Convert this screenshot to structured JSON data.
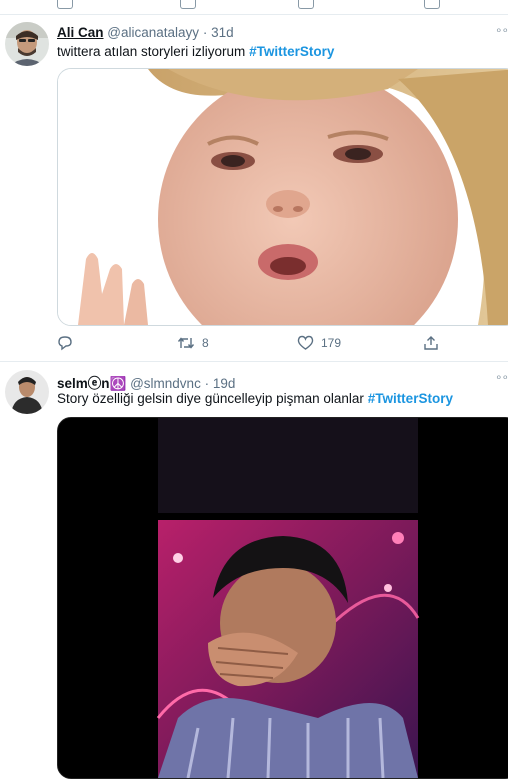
{
  "tweets": [
    {
      "display_name": "Ali Can",
      "handle": "@alicanatalayy",
      "time": "31d",
      "text": "twittera atılan storyleri izliyorum",
      "hashtag": "#TwitterStory",
      "retweets": "8",
      "likes": "179",
      "icons": [
        "reply-icon",
        "retweet-icon",
        "like-icon",
        "share-icon"
      ]
    },
    {
      "display_name": "selmⓔn☮️",
      "handle": "@slmndvnc",
      "time": "19d",
      "text": "Story özelliği gelsin diye güncelleyip pişman olanlar",
      "hashtag": "#TwitterStory"
    }
  ],
  "colors": {
    "accent": "#1b95e0",
    "muted": "#5b7083",
    "border": "#e6ecf0",
    "peace_bg": "#8a4fd0"
  }
}
